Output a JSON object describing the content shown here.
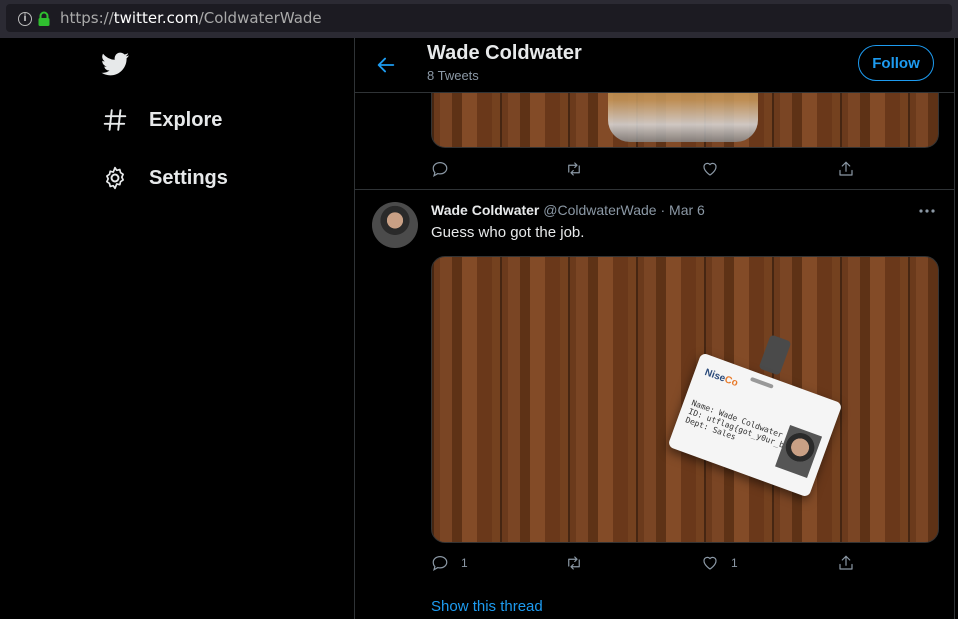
{
  "browser": {
    "url_prefix": "https://",
    "url_host": "twitter.com",
    "url_path": "/ColdwaterWade"
  },
  "nav": {
    "logo_icon": "twitter-bird-icon",
    "items": [
      {
        "label": "Explore",
        "icon": "hashtag-icon"
      },
      {
        "label": "Settings",
        "icon": "gear-icon"
      }
    ]
  },
  "profile": {
    "name": "Wade Coldwater",
    "tweet_count": "8 Tweets",
    "follow_label": "Follow"
  },
  "tweet": {
    "author": "Wade Coldwater",
    "handle": "@ColdwaterWade",
    "separator": "·",
    "date": "Mar 6",
    "text": "Guess who got the job.",
    "reply_count": "1",
    "like_count": "1",
    "badge": {
      "logo": "Nise",
      "logo_suffix": "Co",
      "line1": "Name: Wade Coldwater",
      "line2": "ID: utflag{got_y0ur_b4dg3}",
      "line3": "Dept: Sales"
    }
  },
  "show_thread": "Show this thread",
  "colors": {
    "accent": "#1d9bf0",
    "background": "#000000",
    "muted": "#8b98a5"
  }
}
